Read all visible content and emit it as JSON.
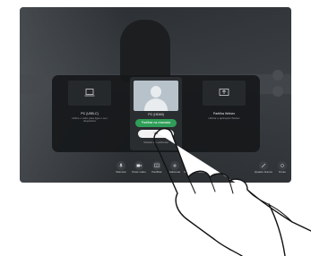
{
  "share_tiles": [
    {
      "title": "PC (USB-C)",
      "subtitle": "Utilize o cabo para ligar o seu dispositivo"
    },
    {
      "title": "PC (HDMI)"
    },
    {
      "title": "Partilha Webex",
      "subtitle": "Utilizar a aplicação Webex"
    }
  ],
  "buttons": {
    "share_in_call": "Partilhar na chamada",
    "stop": "Ver",
    "note": "Mostrar em ecrã local"
  },
  "toolbar": [
    {
      "label": "Silenciar",
      "icon": "mic-icon"
    },
    {
      "label": "Parar vídeo",
      "icon": "camera-icon"
    },
    {
      "label": "Partilhar",
      "icon": "share-icon"
    },
    {
      "label": "Adicionar",
      "icon": "add-icon"
    },
    {
      "label": "Teclado numérico",
      "icon": "keypad-icon"
    },
    {
      "label": "Quadro branco",
      "icon": "whiteboard-icon"
    },
    {
      "label": "Ponto",
      "icon": "pointer-icon"
    }
  ],
  "colors": {
    "accent_green": "#2f9e58",
    "overlay": "#16181a",
    "tile": "#2a2d30"
  }
}
